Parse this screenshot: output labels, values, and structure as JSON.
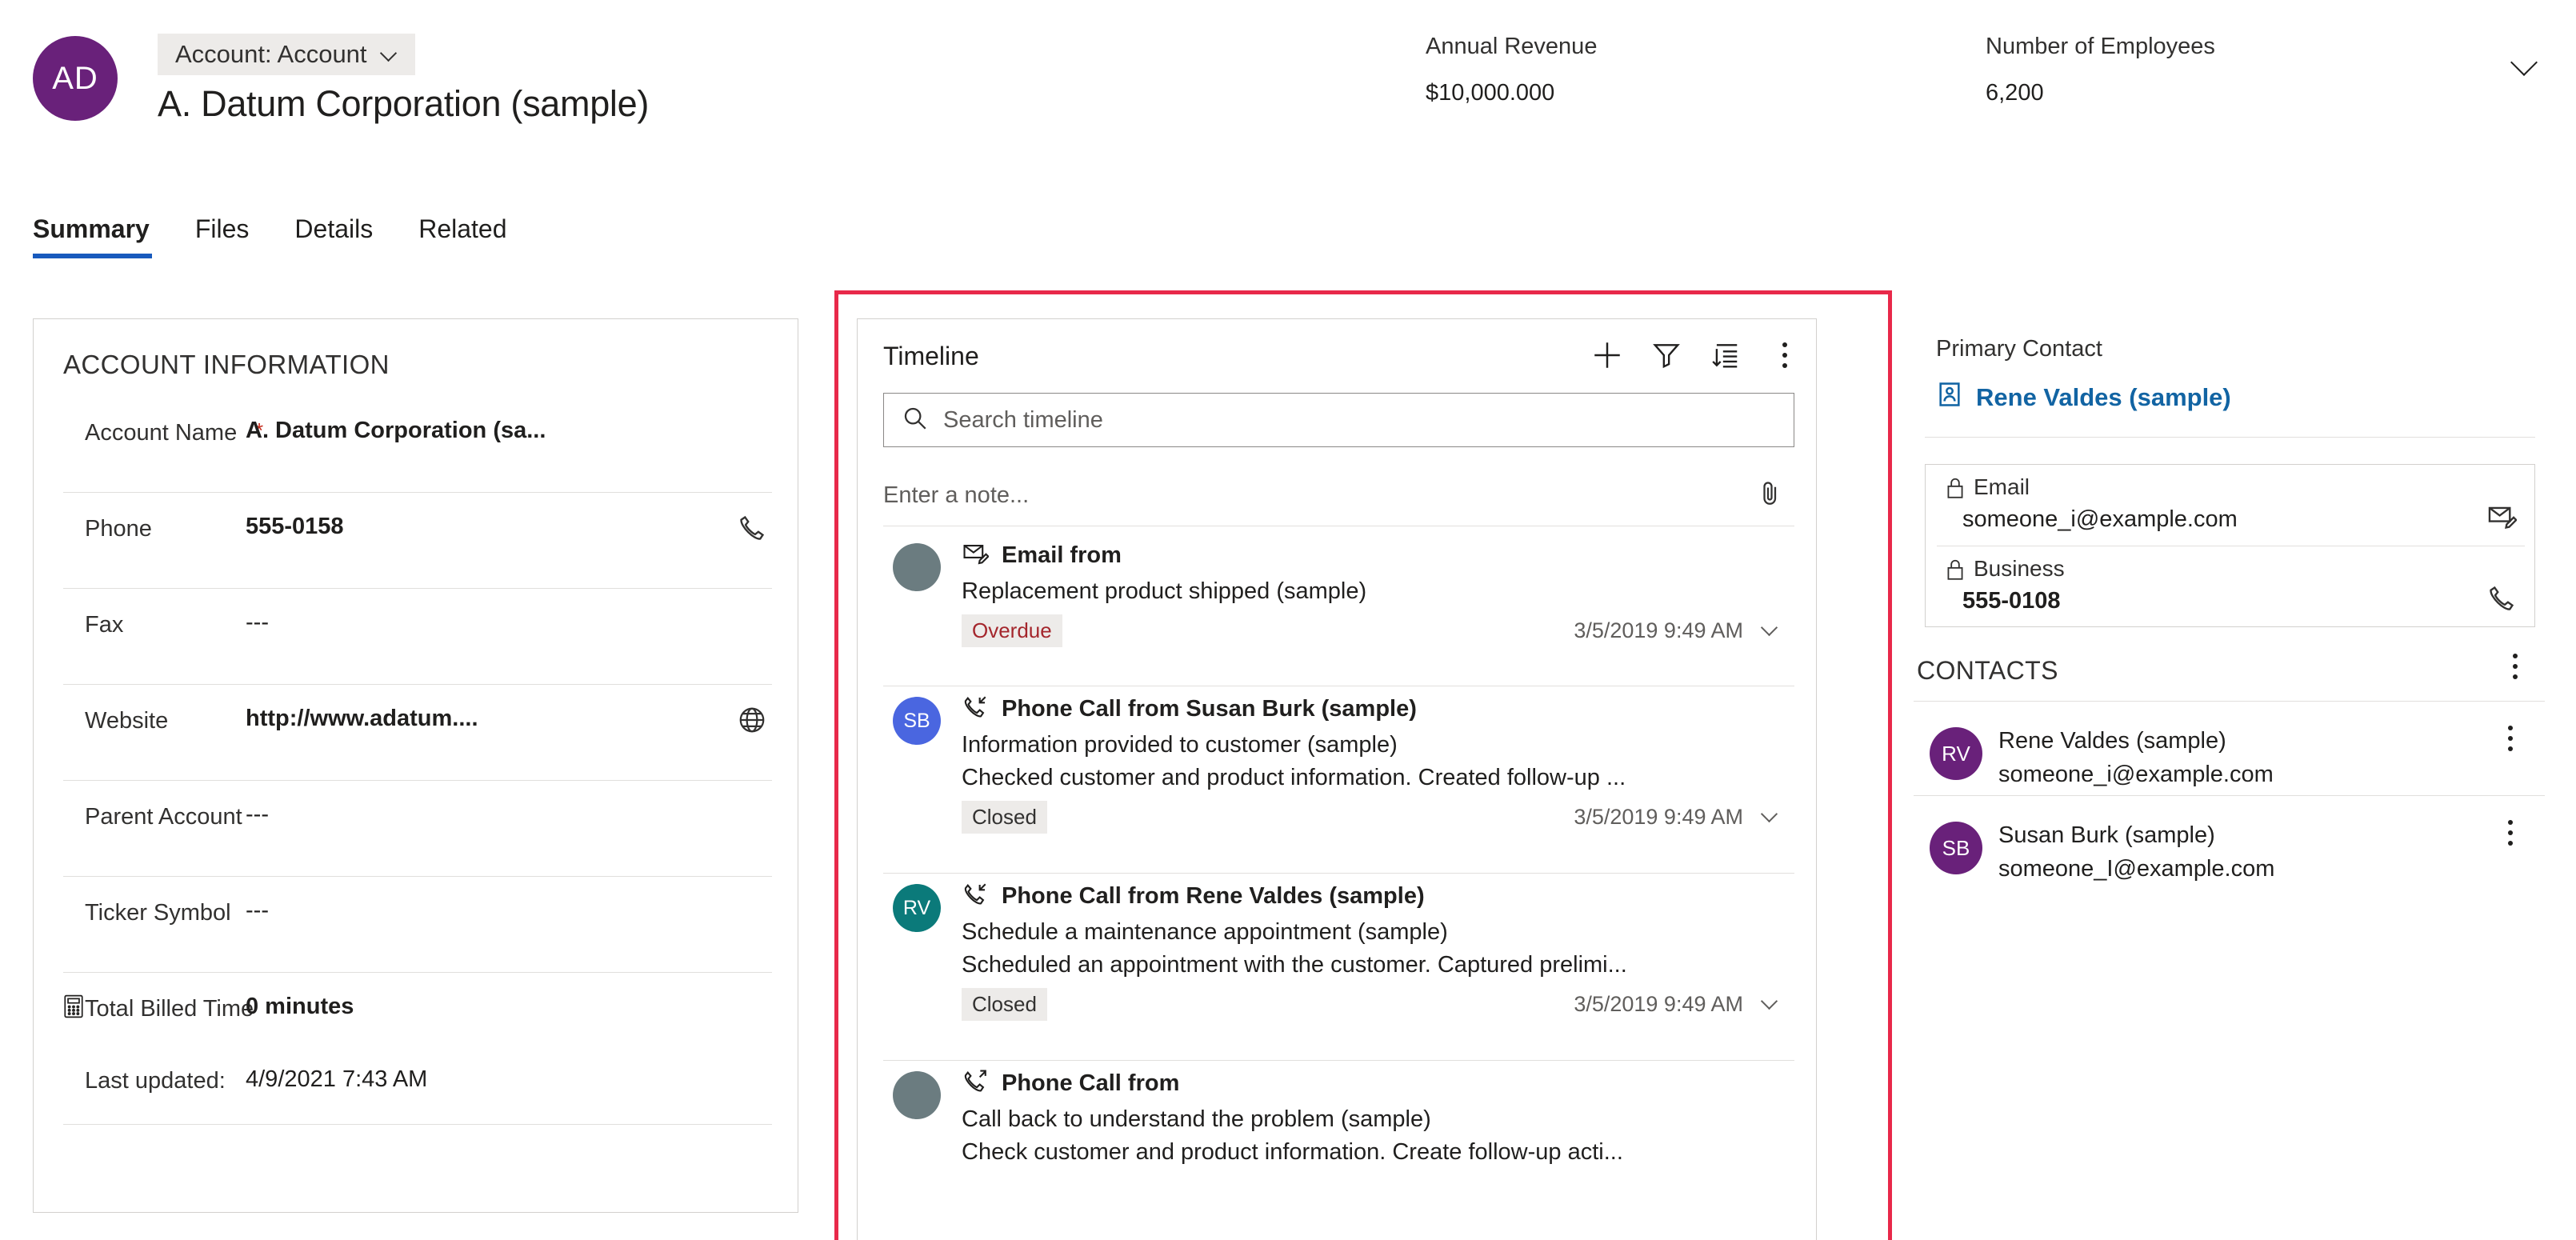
{
  "header": {
    "avatar_initials": "AD",
    "avatar_color": "#69217a",
    "entity_pill": "Account: Account",
    "record_title": "A. Datum Corporation (sample)",
    "stats": [
      {
        "label": "Annual Revenue",
        "value": "$10,000.000"
      },
      {
        "label": "Number of Employees",
        "value": "6,200"
      }
    ],
    "collapse_icon": "chevron-down-icon"
  },
  "tabs": [
    {
      "label": "Summary",
      "active": true
    },
    {
      "label": "Files",
      "active": false
    },
    {
      "label": "Details",
      "active": false
    },
    {
      "label": "Related",
      "active": false
    }
  ],
  "account_information": {
    "title": "ACCOUNT INFORMATION",
    "fields": [
      {
        "label": "Account Name",
        "value": "A. Datum Corporation (sa...",
        "required": "*",
        "bold": true,
        "icon": ""
      },
      {
        "label": "Phone",
        "value": "555-0158",
        "required": "",
        "bold": true,
        "icon": "phone-icon"
      },
      {
        "label": "Fax",
        "value": "---",
        "required": "",
        "bold": false,
        "icon": ""
      },
      {
        "label": "Website",
        "value": "http://www.adatum....",
        "required": "",
        "bold": true,
        "icon": "globe-icon"
      },
      {
        "label": "Parent Account",
        "value": "---",
        "required": "",
        "bold": false,
        "icon": ""
      },
      {
        "label": "Ticker Symbol",
        "value": "---",
        "required": "",
        "bold": false,
        "icon": ""
      }
    ],
    "billed": {
      "icon": "calculator-icon",
      "label": "Total Billed Time",
      "value": "0 minutes"
    },
    "last_updated": {
      "label": "Last updated:",
      "value": "4/9/2021 7:43 AM"
    }
  },
  "timeline": {
    "title": "Timeline",
    "actions": [
      {
        "name": "add-icon"
      },
      {
        "name": "filter-icon"
      },
      {
        "name": "sort-icon"
      },
      {
        "name": "more-options-icon"
      }
    ],
    "search_placeholder": "Search timeline",
    "search_value": "",
    "note_placeholder": "Enter a note...",
    "note_value": "",
    "attach_icon": "paperclip-icon",
    "entries": [
      {
        "avatar_initials": "",
        "avatar_color": "#6b7c80",
        "type_icon": "email-icon",
        "kind": "Email from",
        "subject": "Replacement product shipped (sample)",
        "description": "",
        "badge": "Overdue",
        "badge_state": "overdue",
        "time": "3/5/2019 9:49 AM"
      },
      {
        "avatar_initials": "SB",
        "avatar_color": "#4a66e0",
        "type_icon": "phone-incoming-icon",
        "kind": "Phone Call from Susan Burk (sample)",
        "subject": "Information provided to customer (sample)",
        "description": "Checked customer and product information. Created follow-up ...",
        "badge": "Closed",
        "badge_state": "closed",
        "time": "3/5/2019 9:49 AM"
      },
      {
        "avatar_initials": "RV",
        "avatar_color": "#0b7a7a",
        "type_icon": "phone-incoming-icon",
        "kind": "Phone Call from Rene Valdes (sample)",
        "subject": "Schedule a maintenance appointment (sample)",
        "description": "Scheduled an appointment with the customer. Captured prelimi...",
        "badge": "Closed",
        "badge_state": "closed",
        "time": "3/5/2019 9:49 AM"
      },
      {
        "avatar_initials": "",
        "avatar_color": "#6b7c80",
        "type_icon": "phone-outgoing-icon",
        "kind": "Phone Call from",
        "subject": "Call back to understand the problem (sample)",
        "description": "Check customer and product information. Create follow-up acti...",
        "badge": "",
        "badge_state": "",
        "time": ""
      }
    ]
  },
  "right_panel": {
    "primary_contact_label": "Primary Contact",
    "primary_contact_name": "Rene Valdes (sample)",
    "primary_contact_icon": "contact-card-icon",
    "contact_fields": [
      {
        "lock_icon": "lock-icon",
        "label": "Email",
        "value": "someone_i@example.com",
        "bold": false,
        "action_icon": "email-icon"
      },
      {
        "lock_icon": "lock-icon",
        "label": "Business",
        "value": "555-0108",
        "bold": true,
        "action_icon": "phone-icon"
      }
    ],
    "contacts_title": "CONTACTS",
    "contacts_more_icon": "more-options-icon",
    "contacts": [
      {
        "initials": "RV",
        "name": "Rene Valdes (sample)",
        "email": "someone_i@example.com",
        "more_icon": "more-options-icon"
      },
      {
        "initials": "SB",
        "name": "Susan Burk (sample)",
        "email": "someone_I@example.com",
        "more_icon": "more-options-icon"
      }
    ]
  },
  "highlight": {
    "color": "#e8294a"
  }
}
